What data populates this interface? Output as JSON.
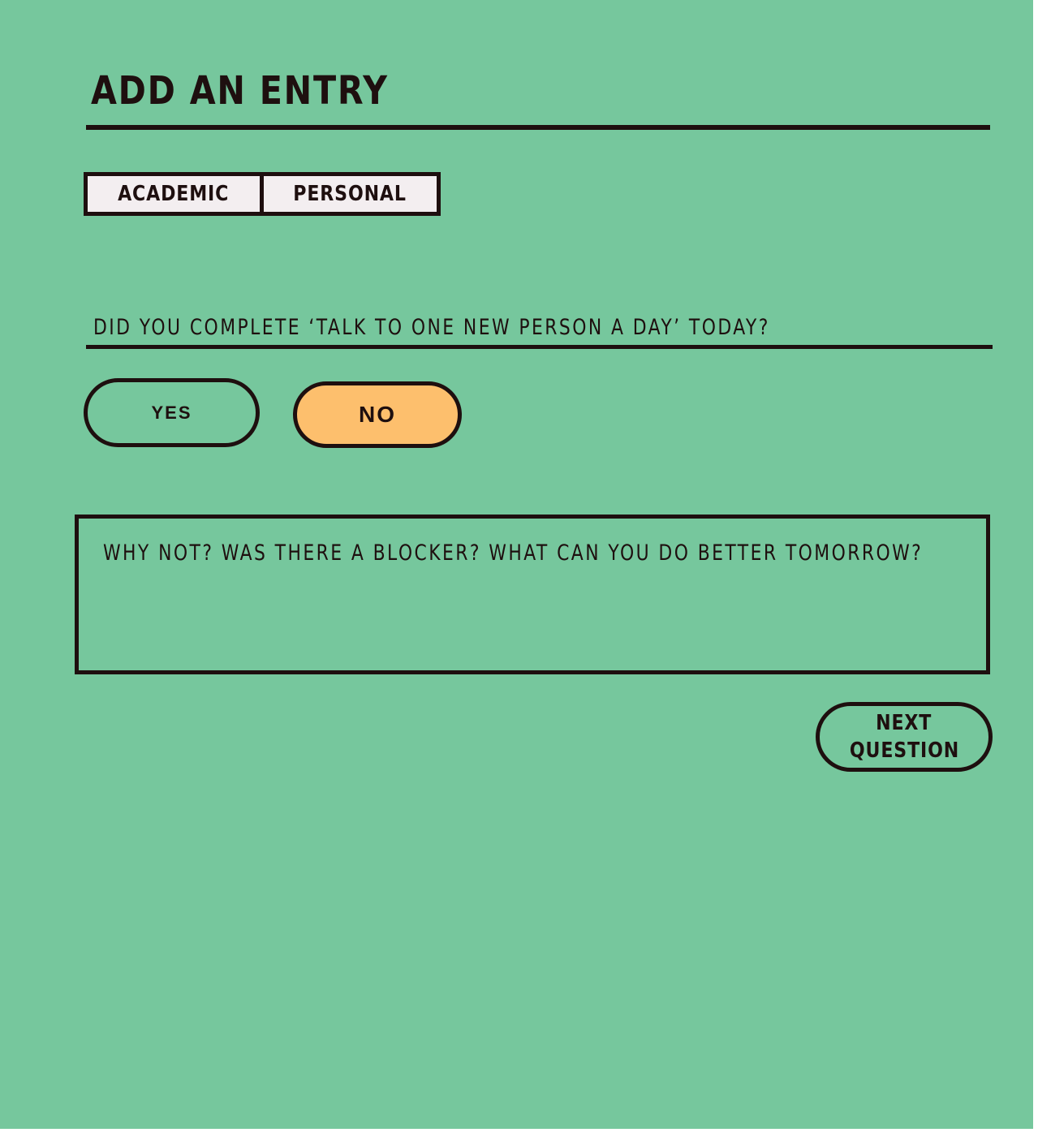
{
  "colors": {
    "background": "#76c79d",
    "ink": "#1e0f0f",
    "tab_fill": "#f3eef0",
    "selected_answer": "#fdbf6d"
  },
  "page": {
    "title": "ADD AN ENTRY"
  },
  "tabs": [
    {
      "label": "ACADEMIC"
    },
    {
      "label": "PERSONAL"
    }
  ],
  "question": {
    "text": "DID YOU COMPLETE ‘TALK TO ONE NEW PERSON A DAY’ TODAY?"
  },
  "answers": {
    "yes_label": "YES",
    "no_label": "NO",
    "selected": "NO"
  },
  "reflection": {
    "placeholder": "WHY NOT? WAS THERE A BLOCKER? WHAT CAN YOU DO BETTER TOMORROW?",
    "value": ""
  },
  "navigation": {
    "next_label_line1": "NEXT",
    "next_label_line2": "QUESTION"
  }
}
